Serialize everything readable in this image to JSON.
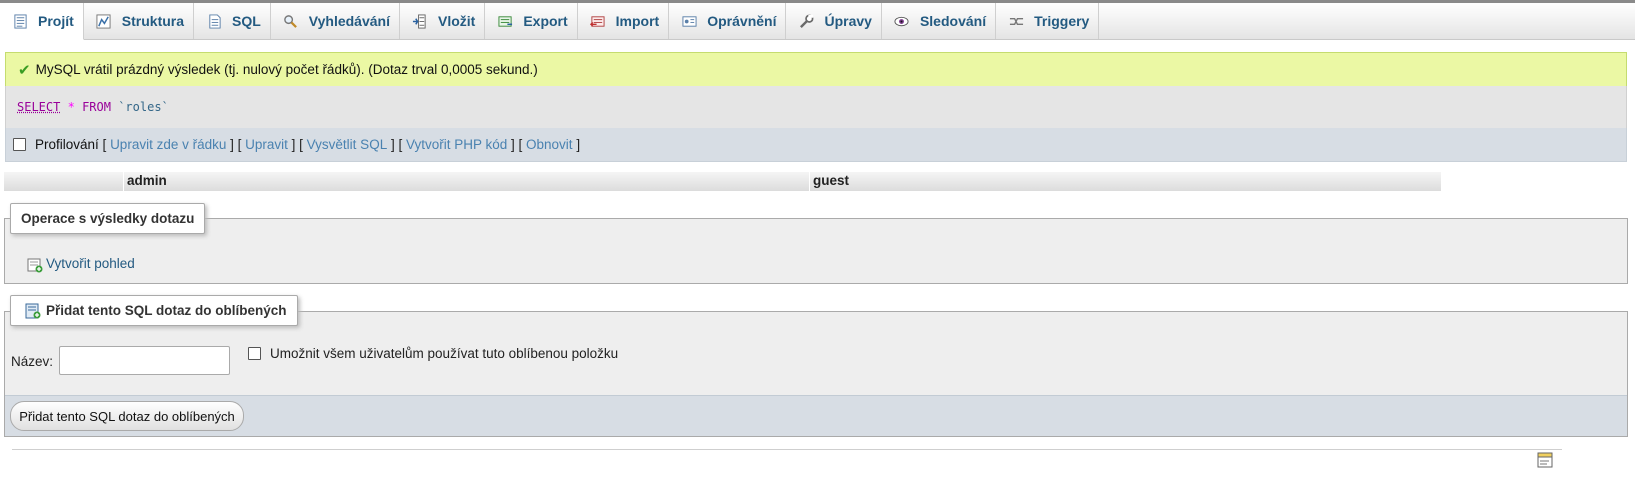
{
  "tabs": [
    {
      "label": "Projít",
      "icon": "browse-icon",
      "active": true
    },
    {
      "label": "Struktura",
      "icon": "structure-icon"
    },
    {
      "label": "SQL",
      "icon": "sql-icon"
    },
    {
      "label": "Vyhledávání",
      "icon": "search-icon"
    },
    {
      "label": "Vložit",
      "icon": "insert-icon"
    },
    {
      "label": "Export",
      "icon": "export-icon"
    },
    {
      "label": "Import",
      "icon": "import-icon"
    },
    {
      "label": "Oprávnění",
      "icon": "privileges-icon"
    },
    {
      "label": "Úpravy",
      "icon": "operations-icon"
    },
    {
      "label": "Sledování",
      "icon": "tracking-icon"
    },
    {
      "label": "Triggery",
      "icon": "triggers-icon"
    }
  ],
  "message": {
    "text": "MySQL vrátil prázdný výsledek (tj. nulový počet řádků). (Dotaz trval 0,0005 sekund.)"
  },
  "query": {
    "select": "SELECT",
    "star": "*",
    "from": "FROM",
    "table": "`roles`"
  },
  "tools": {
    "profiling_label": "Profilování",
    "edit_inline": "Upravit zde v řádku",
    "edit": "Upravit",
    "explain": "Vysvětlit SQL",
    "create_php": "Vytvořit PHP kód",
    "refresh": "Obnovit"
  },
  "results": {
    "columns": [
      "",
      "admin",
      "guest"
    ]
  },
  "query_ops": {
    "legend": "Operace s výsledky dotazu",
    "create_view": "Vytvořit pohled"
  },
  "bookmark": {
    "legend": "Přidat tento SQL dotaz do oblíbených",
    "name_label": "Název:",
    "name_value": "",
    "share_label": "Umožnit všem uživatelům používat tuto oblíbenou položku",
    "submit_label": "Přidat tento SQL dotaz do oblíbených"
  },
  "colors": {
    "link": "#235a81",
    "success_bg": "#ebf8a4",
    "tools_bg": "#d7dde4"
  }
}
